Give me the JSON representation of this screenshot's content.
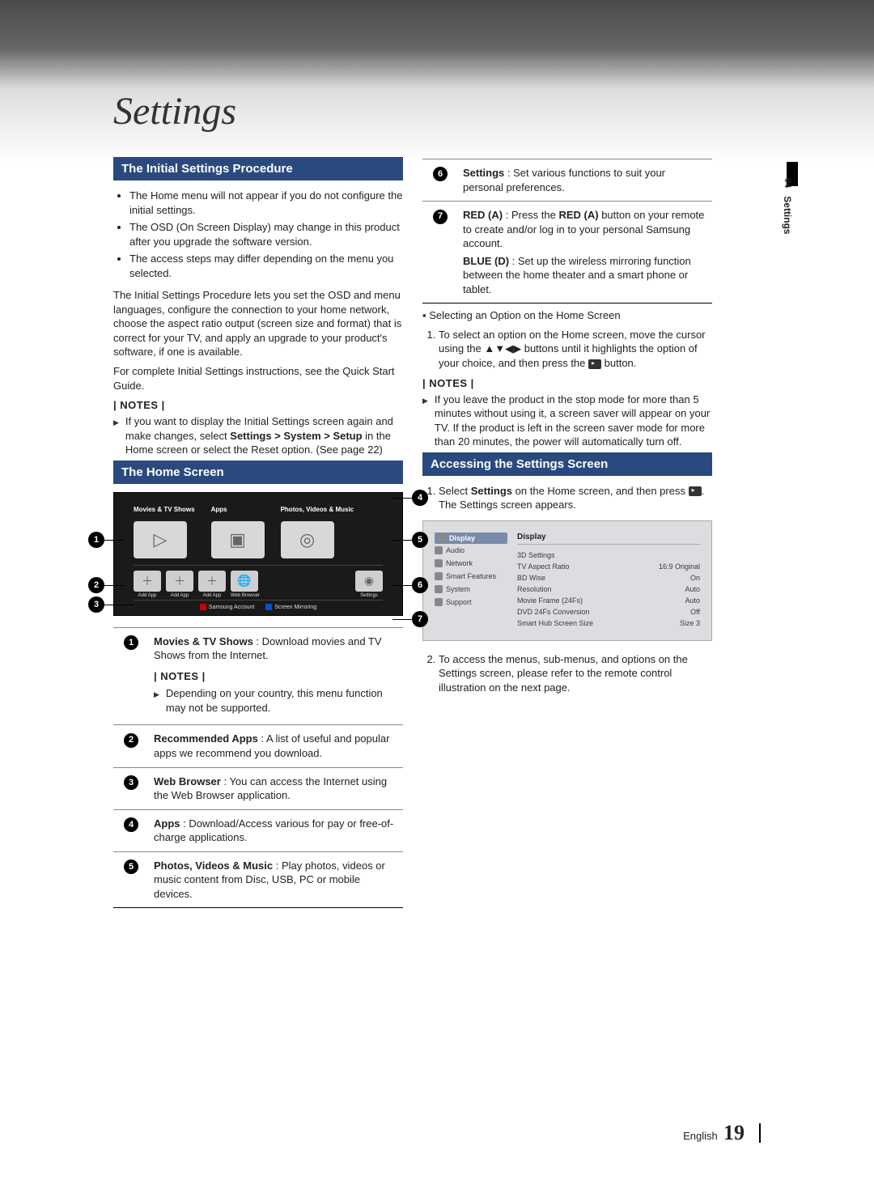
{
  "page_title": "Settings",
  "side_tab": {
    "num": "04",
    "label": "Settings"
  },
  "section1": {
    "heading": "The Initial Settings Procedure",
    "bullets": [
      "The Home menu will not appear if you do not configure the initial settings.",
      "The OSD (On Screen Display) may change in this product after you upgrade the software version.",
      "The access steps may differ depending on the menu you selected."
    ],
    "para1": "The Initial Settings Procedure lets you set the OSD and menu languages, configure the connection to your home network, choose the aspect ratio output (screen size and format) that is correct for your TV, and apply an upgrade to your product's software, if one is available.",
    "para2": "For complete Initial Settings instructions, see the Quick Start Guide.",
    "notes_label": "| NOTES |",
    "note1_a": "If you want to display the Initial Settings screen again and make changes, select ",
    "note1_b": "Settings > System > Setup",
    "note1_c": " in the Home screen or select the Reset option. (See page 22)"
  },
  "section2": {
    "heading": "The Home Screen",
    "tiles": {
      "t1": "Movies & TV Shows",
      "t2": "Apps",
      "t3": "Photos, Videos & Music"
    },
    "small": {
      "s1": "Add App",
      "s2": "Add App",
      "s3": "Add App",
      "s4": "Web Browser",
      "s5": "Settings"
    },
    "bottom": {
      "a_label": "Samsung Account",
      "d_label": "Screen Mirroring"
    }
  },
  "desc_table": [
    {
      "num": "1",
      "bold": "Movies & TV Shows",
      "text": " : Download movies and TV Shows from the Internet.",
      "notes_label": "| NOTES |",
      "note": "Depending on your country, this menu function may not be supported."
    },
    {
      "num": "2",
      "bold": "Recommended Apps",
      "text": " : A list of useful and popular apps we recommend you download."
    },
    {
      "num": "3",
      "bold": "Web Browser",
      "text": " : You can access the Internet using the Web Browser application."
    },
    {
      "num": "4",
      "bold": "Apps",
      "text": " : Download/Access various for pay or free-of-charge applications."
    },
    {
      "num": "5",
      "bold": "Photos, Videos & Music",
      "text": " : Play photos, videos or music content from Disc, USB, PC or mobile devices."
    }
  ],
  "desc_table_right": [
    {
      "num": "6",
      "bold": "Settings",
      "text": " : Set various functions to suit your personal preferences."
    },
    {
      "num": "7",
      "lines": [
        {
          "bold": "RED (A)",
          "text": " : Press the ",
          "bold2": "RED (A)",
          "text2": " button on your remote to create and/or log in to your personal Samsung account."
        },
        {
          "bold": "BLUE (D)",
          "text": " : Set up the wireless mirroring function between the home theater and a smart phone or tablet."
        }
      ]
    }
  ],
  "select_option": {
    "heading": "Selecting an Option on the Home Screen",
    "step1_a": "To select an option on the Home screen, move the cursor using the ▲▼◀▶ buttons until it highlights the option of your choice, and then press the ",
    "step1_b": " button."
  },
  "right_notes": {
    "label": "| NOTES |",
    "text": "If you leave the product in the stop mode for more than 5 minutes without using it, a screen saver will appear on your TV. If the product is left in the screen saver mode for more than 20 minutes, the power will automatically turn off."
  },
  "section3": {
    "heading": "Accessing the Settings Screen",
    "step1_a": "Select ",
    "step1_b": "Settings",
    "step1_c": " on the Home screen, and then press ",
    "step1_d": ". The Settings screen appears.",
    "step2": "To access the menus, sub-menus, and options on the Settings screen, please refer to the remote control illustration on the next page."
  },
  "settings_fig": {
    "title": "Display",
    "side": [
      "Display",
      "Audio",
      "Network",
      "Smart Features",
      "System",
      "Support"
    ],
    "rows": [
      {
        "k": "3D Settings",
        "v": ""
      },
      {
        "k": "TV Aspect Ratio",
        "v": "16:9 Original"
      },
      {
        "k": "BD Wise",
        "v": "On"
      },
      {
        "k": "Resolution",
        "v": "Auto"
      },
      {
        "k": "Movie Frame (24Fs)",
        "v": "Auto"
      },
      {
        "k": "DVD 24Fs Conversion",
        "v": "Off"
      },
      {
        "k": "Smart Hub Screen Size",
        "v": "Size 3"
      }
    ]
  },
  "footer": {
    "lang": "English",
    "page": "19"
  }
}
